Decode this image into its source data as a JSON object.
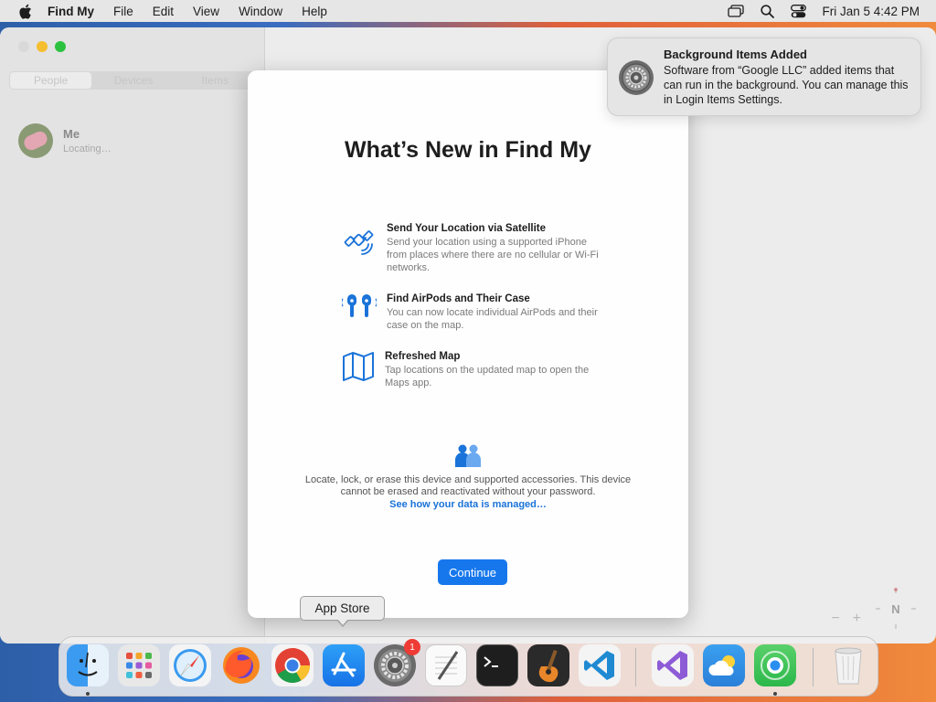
{
  "menubar": {
    "app_name": "Find My",
    "items": [
      "File",
      "Edit",
      "View",
      "Window",
      "Help"
    ],
    "clock": "Fri Jan 5  4:42 PM"
  },
  "sidebar": {
    "tabs": [
      "People",
      "Devices",
      "Items"
    ],
    "me": {
      "name": "Me",
      "status": "Locating…"
    }
  },
  "map": {
    "zoom_out": "−",
    "zoom_in": "+",
    "compass": "N"
  },
  "dialog": {
    "title": "What’s New in Find My",
    "features": [
      {
        "icon": "satellite-icon",
        "title": "Send Your Location via Satellite",
        "body": "Send your location using a supported iPhone from places where there are no cellular or Wi-Fi networks."
      },
      {
        "icon": "airpods-icon",
        "title": "Find AirPods and Their Case",
        "body": "You can now locate individual AirPods and their case on the map."
      },
      {
        "icon": "map-icon",
        "title": "Refreshed Map",
        "body": "Tap locations on the updated map to open the Maps app."
      }
    ],
    "privacy_text": "Locate, lock, or erase this device and supported accessories. This device cannot be erased and reactivated without your password.",
    "privacy_link": "See how your data is managed…",
    "continue_label": "Continue"
  },
  "notification": {
    "title": "Background Items Added",
    "body": "Software from “Google LLC” added items that can run in the background. You can manage this in Login Items Settings."
  },
  "tooltip": "App Store",
  "dock": {
    "apps": [
      "Finder",
      "Launchpad",
      "Safari",
      "Firefox",
      "Google Chrome",
      "App Store",
      "System Settings",
      "TextEdit",
      "Terminal",
      "GarageBand",
      "Visual Studio Code",
      "Visual Studio",
      "Weather",
      "Find My",
      "Trash"
    ],
    "settings_badge": "1"
  },
  "colors": {
    "accent": "#1677ed",
    "link": "#1a73d9",
    "badge": "#ef3b35"
  }
}
